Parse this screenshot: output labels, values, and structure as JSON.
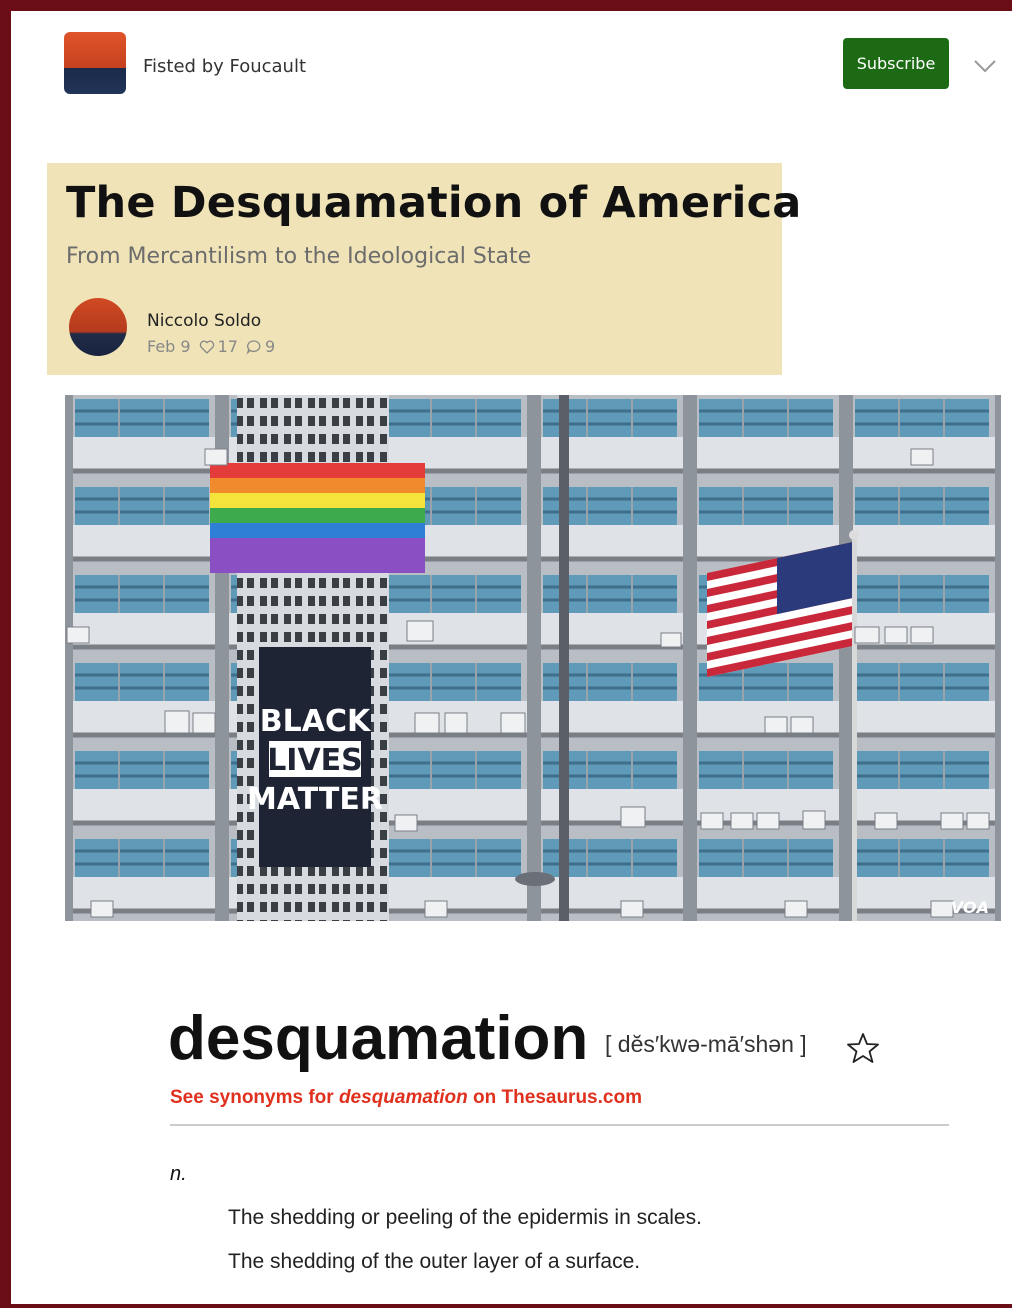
{
  "publication": {
    "name": "Fisted by Foucault",
    "subscribe_label": "Subscribe"
  },
  "post": {
    "title": "The Desquamation of America",
    "subtitle": "From Mercantilism to the Ideological State",
    "author": "Niccolo Soldo",
    "date": "Feb 9",
    "likes": "17",
    "comments": "9",
    "header_bg": "#efe3b7"
  },
  "hero_image": {
    "banner_text": [
      "BLACK",
      "LIVES",
      "MATTER"
    ],
    "watermark": "VOA"
  },
  "dictionary": {
    "word": "desquamation",
    "pronunciation": "[ dĕs′kwə-mā′shən ]",
    "synonyms_prefix": "See synonyms for ",
    "synonyms_word": "desquamation",
    "synonyms_suffix": " on Thesaurus.com",
    "part_of_speech": "n.",
    "definitions": [
      "The shedding or peeling of the epidermis in scales.",
      "The shedding of the outer layer of a surface."
    ]
  },
  "colors": {
    "frame": "#6b0d16",
    "subscribe": "#1c6b14",
    "synonyms_link": "#e0301e"
  }
}
